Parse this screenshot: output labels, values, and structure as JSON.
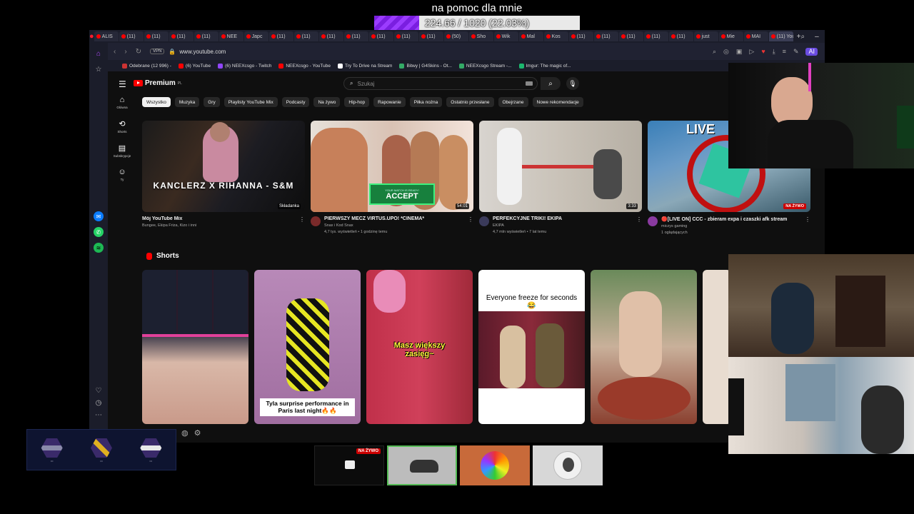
{
  "goal": {
    "title": "na pomoc dla mnie",
    "progress_text": "224.66 / 1020 (22.03%)",
    "fraction": 0.2203
  },
  "browser": {
    "tabs": [
      "ALIS",
      "(11)",
      "(11)",
      "(11)",
      "(11)",
      "NEE",
      "Japc",
      "(11)",
      "(11)",
      "(11)",
      "(11)",
      "(11)",
      "(11)",
      "(11)",
      "(50)",
      "Sho",
      "Wik",
      "Mal",
      "Kos",
      "(11)",
      "(11)",
      "(11)",
      "(11)",
      "(11)",
      "just",
      "Mie",
      "MAI",
      "(11) You"
    ],
    "url": "www.youtube.com",
    "vpn_label": "VPN",
    "bookmarks": [
      "Odebrane (12 996) -",
      "(6) YouTube",
      "(6) NEEXcsgo - Twitch",
      "NEEXcsgo - YouTube",
      "Try To Drive na Stream",
      "Bitwy | G4Skins - Ot...",
      "NEEXcsgo Stream -...",
      "Imgur: The magic of..."
    ],
    "ai_label": "AI"
  },
  "youtube": {
    "logo_text": "Premium",
    "logo_region": "PL",
    "search_placeholder": "Szukaj",
    "sidebar": [
      {
        "icon": "home-icon",
        "label": "Główna"
      },
      {
        "icon": "shorts-icon",
        "label": "Shorts"
      },
      {
        "icon": "subscriptions-icon",
        "label": "Subskrypcje"
      },
      {
        "icon": "you-icon",
        "label": "Ty"
      }
    ],
    "chips": [
      "Wszystko",
      "Muzyka",
      "Gry",
      "Playlisty YouTube Mix",
      "Podcasty",
      "Na żywo",
      "Hip-hop",
      "Rapowanie",
      "Piłka nożna",
      "Ostatnio przesłane",
      "Obejrzane",
      "Nowe rekomendacje"
    ],
    "videos": [
      {
        "title": "Mój YouTube Mix",
        "channel": "Bungee, Ekipa Friza, Kizo i inni",
        "stats": "",
        "thumb_text": "KANCLERZ X RIHANNA - S&M",
        "badge": "Składanka"
      },
      {
        "title": "PIERWSZY MECZ VIRTUS.UPO! *CINEMA*",
        "channel": "Snax i Kod Snax",
        "stats": "4,7 tys. wyświetleń • 1 godzinę temu",
        "duration": "54:01",
        "accept_text": "ACCEPT",
        "accept_sub": "YOUR MATCH IS READY!"
      },
      {
        "title": "PERFEKCYJNE TRIKI! EKIPA",
        "channel": "EKIPA",
        "stats": "4,7 mln wyświetleń • 7 lat temu",
        "duration": "3:33"
      },
      {
        "title": "🔴[LIVE ON] CCC - zbieram expa i czaszki afk stream",
        "channel": "miczys gaming",
        "stats": "1 oglądających",
        "live_badge": "NA ŻYWO",
        "thumb_text": "LIVE"
      }
    ],
    "shorts_title": "Shorts",
    "shorts": [
      {
        "caption": ""
      },
      {
        "caption": "Tyla surprise performance in Paris last night🔥🔥"
      },
      {
        "caption": "Masz większy zasięg~"
      },
      {
        "caption": "Everyone freeze for seconds 😂"
      },
      {
        "caption": ""
      }
    ]
  },
  "stream_cards": {
    "live_badge": "NA ŻYWO"
  },
  "colors": {
    "yt_bg": "#0f0f0f",
    "yt_red": "#ff0000",
    "goal_purple": "#8a2be2",
    "opera_sidebar": "#1b1d2a"
  }
}
